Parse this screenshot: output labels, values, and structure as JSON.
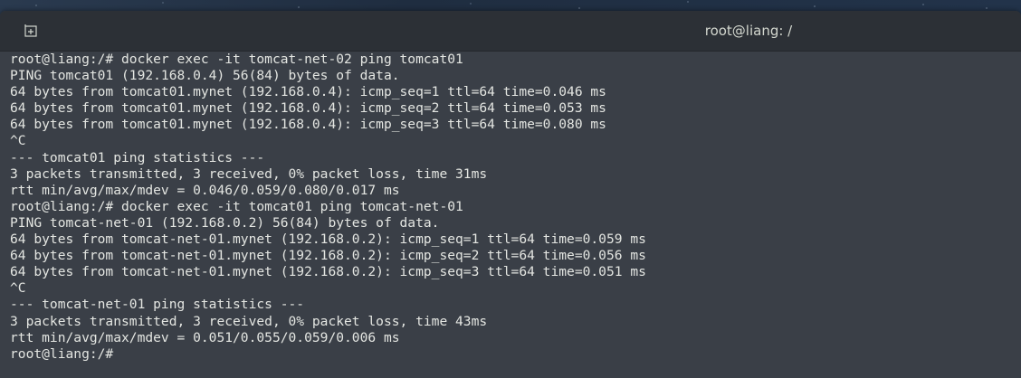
{
  "window": {
    "title": "root@liang: /",
    "new_tab_icon": "new-tab-icon"
  },
  "terminal": {
    "lines": [
      "root@liang:/# docker exec -it tomcat-net-02 ping tomcat01",
      "PING tomcat01 (192.168.0.4) 56(84) bytes of data.",
      "64 bytes from tomcat01.mynet (192.168.0.4): icmp_seq=1 ttl=64 time=0.046 ms",
      "64 bytes from tomcat01.mynet (192.168.0.4): icmp_seq=2 ttl=64 time=0.053 ms",
      "64 bytes from tomcat01.mynet (192.168.0.4): icmp_seq=3 ttl=64 time=0.080 ms",
      "^C",
      "--- tomcat01 ping statistics ---",
      "3 packets transmitted, 3 received, 0% packet loss, time 31ms",
      "rtt min/avg/max/mdev = 0.046/0.059/0.080/0.017 ms",
      "root@liang:/# docker exec -it tomcat01 ping tomcat-net-01",
      "PING tomcat-net-01 (192.168.0.2) 56(84) bytes of data.",
      "64 bytes from tomcat-net-01.mynet (192.168.0.2): icmp_seq=1 ttl=64 time=0.059 ms",
      "64 bytes from tomcat-net-01.mynet (192.168.0.2): icmp_seq=2 ttl=64 time=0.056 ms",
      "64 bytes from tomcat-net-01.mynet (192.168.0.2): icmp_seq=3 ttl=64 time=0.051 ms",
      "^C",
      "--- tomcat-net-01 ping statistics ---",
      "3 packets transmitted, 3 received, 0% packet loss, time 43ms",
      "rtt min/avg/max/mdev = 0.051/0.055/0.059/0.006 ms",
      "root@liang:/#"
    ]
  },
  "colors": {
    "terminal_bg": "#3a3f47",
    "titlebar_bg": "#2c3036",
    "text": "#e4e6e2"
  }
}
